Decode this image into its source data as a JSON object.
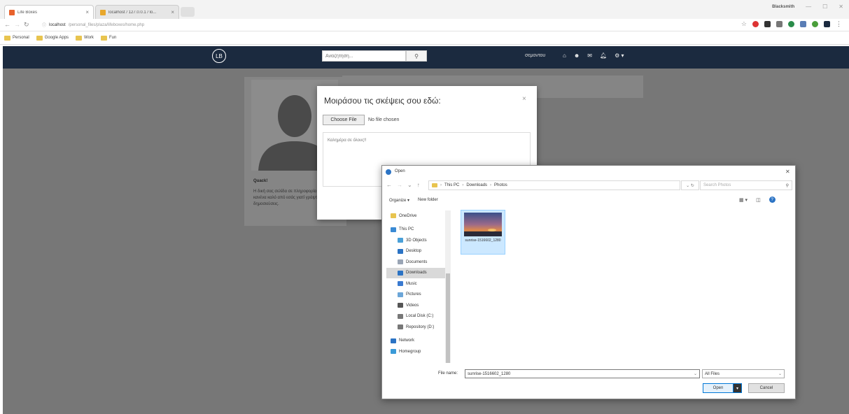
{
  "browser": {
    "tabs": [
      {
        "title": "Life Boxes",
        "active": true
      },
      {
        "title": "localhost / 127.0.0.1 / lo...",
        "active": false
      }
    ],
    "profile": "Blacksmith",
    "url_host": "localhost",
    "url_path": "/personal_files/plaza/lifeboxes/home.php",
    "bookmarks": [
      "Personal",
      "Google Apps",
      "Work",
      "Fun"
    ]
  },
  "site": {
    "logo": "LB",
    "search_placeholder": "Αναζήτηση...",
    "user": "σεμοντου"
  },
  "profile_card": {
    "name": "Quack!",
    "bio": "Η δική σας σελίδα σε πληροφορία από εδώ, κανένα καλό από εσάς γιατί γράψτε εδώ δημοσιεύσεις."
  },
  "modal": {
    "title": "Μοιράσου τις σκέψεις σου εδώ:",
    "close": "×",
    "choose_file": "Choose File",
    "no_file": "No file chosen",
    "post_placeholder": "Καλημέρα σε όλους!!"
  },
  "dialog": {
    "title": "Open",
    "path": [
      "This PC",
      "Downloads",
      "Photos"
    ],
    "search_placeholder": "Search Photos",
    "organize": "Organize ▾",
    "new_folder": "New folder",
    "tree": [
      {
        "label": "OneDrive",
        "icon": "cloud-folder-icon",
        "selected": false,
        "indent": false
      },
      {
        "label": "This PC",
        "icon": "computer-icon",
        "selected": false,
        "indent": false
      },
      {
        "label": "3D Objects",
        "icon": "cube-icon",
        "selected": false,
        "indent": true
      },
      {
        "label": "Desktop",
        "icon": "desktop-icon",
        "selected": false,
        "indent": true
      },
      {
        "label": "Documents",
        "icon": "document-icon",
        "selected": false,
        "indent": true
      },
      {
        "label": "Downloads",
        "icon": "download-icon",
        "selected": true,
        "indent": true
      },
      {
        "label": "Music",
        "icon": "music-icon",
        "selected": false,
        "indent": true
      },
      {
        "label": "Pictures",
        "icon": "pictures-icon",
        "selected": false,
        "indent": true
      },
      {
        "label": "Videos",
        "icon": "video-icon",
        "selected": false,
        "indent": true
      },
      {
        "label": "Local Disk (C:)",
        "icon": "disk-icon",
        "selected": false,
        "indent": true
      },
      {
        "label": "Repository (D:)",
        "icon": "disk-icon",
        "selected": false,
        "indent": true
      },
      {
        "label": "Network",
        "icon": "network-icon",
        "selected": false,
        "indent": false
      },
      {
        "label": "Homegroup",
        "icon": "homegroup-icon",
        "selected": false,
        "indent": false
      }
    ],
    "file": {
      "name": "sunrise-1516602_1280"
    },
    "file_name_label": "File name:",
    "file_name_value": "sunrise-1516602_1280",
    "filter": "All Files",
    "open": "Open",
    "cancel": "Cancel"
  },
  "colors": {
    "navbar": "#1b2a3f",
    "overlay": "#777777",
    "accent": "#0078d7"
  }
}
